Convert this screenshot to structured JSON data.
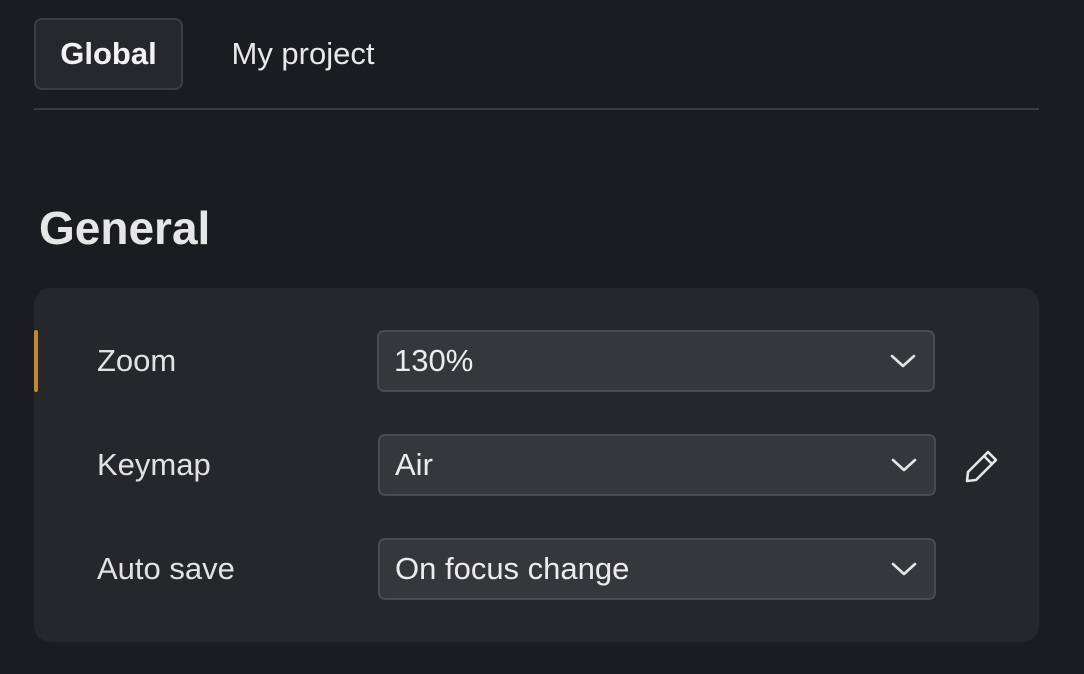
{
  "tabs": [
    {
      "label": "Global",
      "active": true
    },
    {
      "label": "My project",
      "active": false
    }
  ],
  "section": {
    "title": "General"
  },
  "settings": {
    "zoom": {
      "label": "Zoom",
      "value": "130%"
    },
    "keymap": {
      "label": "Keymap",
      "value": "Air"
    },
    "autosave": {
      "label": "Auto save",
      "value": "On focus change"
    }
  },
  "icons": {
    "dropdown": "chevron-down-icon",
    "edit": "pencil-icon"
  },
  "colors": {
    "background": "#1b1c1f",
    "card": "#26272b",
    "accent": "#c2892f",
    "text": "#e6e6e6"
  }
}
